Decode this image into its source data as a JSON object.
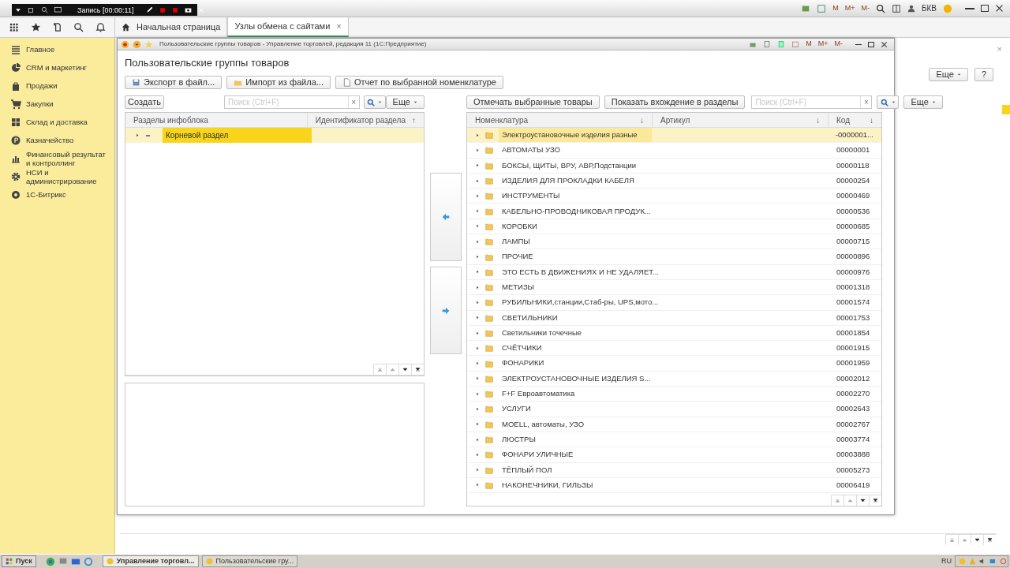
{
  "recorder": {
    "text": "Запись [00:00:11]"
  },
  "main_window": {
    "memory_buttons": [
      "M",
      "M+",
      "M-"
    ],
    "user": "БКВ"
  },
  "tabs": [
    {
      "label": "Начальная страница",
      "selected": false,
      "kind": "home"
    },
    {
      "label": "Узлы обмена с сайтами",
      "selected": true,
      "kind": "closable",
      "close_mark": "×"
    }
  ],
  "sidebar": {
    "items": [
      {
        "label": "Главное"
      },
      {
        "label": "CRM и маркетинг"
      },
      {
        "label": "Продажи"
      },
      {
        "label": "Закупки"
      },
      {
        "label": "Склад и доставка"
      },
      {
        "label": "Казначейство"
      },
      {
        "label": "Финансовый результат и контроллинг"
      },
      {
        "label": "НСИ и администрирование"
      },
      {
        "label": "1С-Битрикс"
      }
    ]
  },
  "background": {
    "more_button": "Еще",
    "help_button": "?",
    "close_mark": "×"
  },
  "dialog": {
    "title": "Пользовательские группы товаров - Управление торговлей, редакция 11 (1С:Предприятие)",
    "memory_buttons": [
      "M",
      "M+",
      "M-"
    ],
    "heading": "Пользовательские группы товаров",
    "commands": [
      "Экспорт в файл...",
      "Импорт из файла...",
      "Отчет по выбранной номенклатуре"
    ],
    "left": {
      "create_button": "Создать",
      "search_placeholder": "Поиск (Ctrl+F)",
      "clear_mark": "×",
      "more_button": "Еще",
      "columns": [
        {
          "label": "Разделы инфоблока"
        },
        {
          "label": "Идентификатор раздела",
          "sort": "↑"
        }
      ],
      "rows": [
        {
          "name": "Корневой раздел",
          "selected": true
        }
      ]
    },
    "right": {
      "buttons": [
        "Отмечать выбранные товары",
        "Показать вхождение в разделы"
      ],
      "search_placeholder": "Поиск (Ctrl+F)",
      "clear_mark": "×",
      "more_button": "Еще",
      "columns": [
        {
          "label": "Номенклатура",
          "sort": "↓"
        },
        {
          "label": "Артикул",
          "sort": "↓"
        },
        {
          "label": "Код",
          "sort": "↓"
        }
      ],
      "rows": [
        {
          "name": "Электроустановочные изделия разные",
          "code": "-0000001...",
          "selected": true
        },
        {
          "name": "АВТОМАТЫ УЗО",
          "code": "00000001",
          "selected": false
        },
        {
          "name": "БОКСЫ, ЩИТЫ, ВРУ, АВР,Подстанции",
          "code": "00000118",
          "selected": false
        },
        {
          "name": "ИЗДЕЛИЯ ДЛЯ ПРОКЛАДКИ КАБЕЛЯ",
          "code": "00000254",
          "selected": false
        },
        {
          "name": "ИНСТРУМЕНТЫ",
          "code": "00000469",
          "selected": false
        },
        {
          "name": "КАБЕЛЬНО-ПРОВОДНИКОВАЯ ПРОДУК...",
          "code": "00000536",
          "selected": false
        },
        {
          "name": "КОРОБКИ",
          "code": "00000685",
          "selected": false
        },
        {
          "name": "ЛАМПЫ",
          "code": "00000715",
          "selected": false
        },
        {
          "name": "ПРОЧИЕ",
          "code": "00000896",
          "selected": false
        },
        {
          "name": "ЭТО ЕСТЬ В ДВИЖЕНИЯХ И НЕ УДАЛЯЕТ...",
          "code": "00000976",
          "selected": false
        },
        {
          "name": "МЕТИЗЫ",
          "code": "00001318",
          "selected": false
        },
        {
          "name": "РУБИЛЬНИКИ,станции,Стаб-ры, UPS,мото...",
          "code": "00001574",
          "selected": false
        },
        {
          "name": "СВЕТИЛЬНИКИ",
          "code": "00001753",
          "selected": false
        },
        {
          "name": "Светильники  точечные",
          "code": "00001854",
          "selected": false
        },
        {
          "name": "СЧЁТЧИКИ",
          "code": "00001915",
          "selected": false
        },
        {
          "name": "ФОНАРИКИ",
          "code": "00001959",
          "selected": false
        },
        {
          "name": "ЭЛЕКТРОУСТАНОВОЧНЫЕ ИЗДЕЛИЯ  S...",
          "code": "00002012",
          "selected": false
        },
        {
          "name": "F+F Евроавтоматика",
          "code": "00002270",
          "selected": false
        },
        {
          "name": "УСЛУГИ",
          "code": "00002643",
          "selected": false
        },
        {
          "name": "MOELL, автоматы, УЗО",
          "code": "00002767",
          "selected": false
        },
        {
          "name": "ЛЮСТРЫ",
          "code": "00003774",
          "selected": false
        },
        {
          "name": "ФОНАРИ УЛИЧНЫЕ",
          "code": "00003888",
          "selected": false
        },
        {
          "name": "ТЁПЛЫЙ ПОЛ",
          "code": "00005273",
          "selected": false
        },
        {
          "name": "НАКОНЕЧНИКИ,  ГИЛЬЗЫ",
          "code": "00006419",
          "selected": false
        }
      ]
    }
  },
  "taskbar": {
    "start": "Пуск",
    "tasks": [
      {
        "label": "Управление торговл...",
        "selected": true
      },
      {
        "label": "Пользовательские гру...",
        "selected": false
      }
    ],
    "language": "RU"
  }
}
